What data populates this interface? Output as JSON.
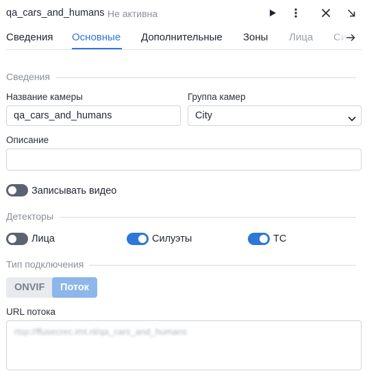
{
  "header": {
    "title": "qa_cars_and_humans",
    "status": "Не активна",
    "icons": [
      "play-icon",
      "more-vertical-icon",
      "close-icon",
      "minimize-arrow-icon"
    ]
  },
  "tabs": [
    {
      "label": "Сведения",
      "state": "normal"
    },
    {
      "label": "Основные",
      "state": "active"
    },
    {
      "label": "Дополнительные",
      "state": "normal"
    },
    {
      "label": "Зоны",
      "state": "normal"
    },
    {
      "label": "Лица",
      "state": "muted"
    },
    {
      "label": "Си",
      "state": "muted"
    }
  ],
  "info_section": {
    "title": "Сведения",
    "camera_name_label": "Название камеры",
    "camera_name_value": "qa_cars_and_humans",
    "camera_group_label": "Группа камер",
    "camera_group_value": "City",
    "description_label": "Описание",
    "description_value": "",
    "record_video_label": "Записывать видео",
    "record_video_on": false
  },
  "detectors_section": {
    "title": "Детекторы",
    "items": [
      {
        "label": "Лица",
        "on": false
      },
      {
        "label": "Силуэты",
        "on": true
      },
      {
        "label": "ТС",
        "on": true
      }
    ]
  },
  "connection_section": {
    "title": "Тип подключения",
    "options": [
      "ONVIF",
      "Поток"
    ],
    "selected": "Поток",
    "stream_url_label": "URL потока",
    "stream_url_value": "rtsp://ffusecrec.imt.nl/qa_cars_and_humans"
  },
  "colors": {
    "accent": "#2c77d8",
    "toggle_off": "#5c6270",
    "segment_active": "#8db6ea"
  }
}
